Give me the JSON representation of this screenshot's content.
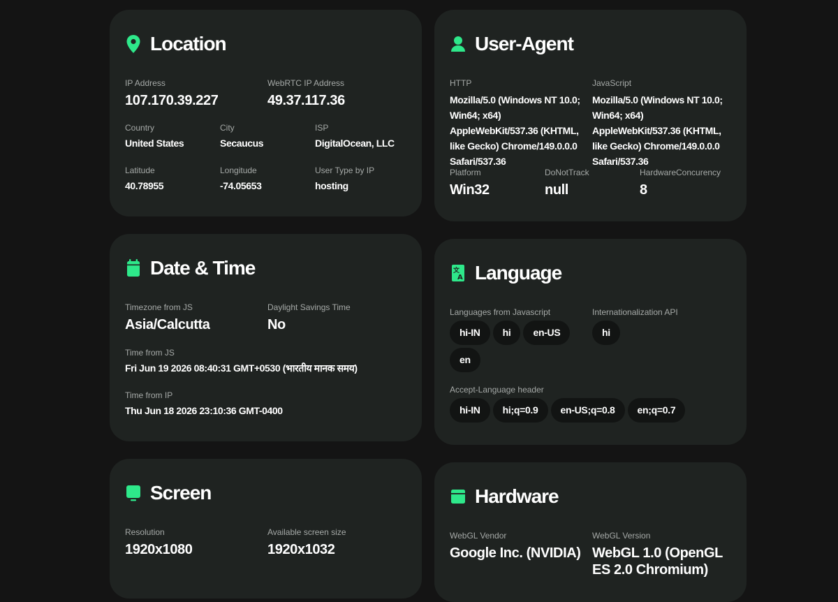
{
  "colors": {
    "accent": "#2ee88a",
    "background": "#141414",
    "card": "#1f2321",
    "label": "#a6aaa8"
  },
  "location": {
    "title": "Location",
    "icon": "map-pin-icon",
    "ip_label": "IP Address",
    "ip_value": "107.170.39.227",
    "webrtc_label": "WebRTC IP Address",
    "webrtc_value": "49.37.117.36",
    "country_label": "Country",
    "country_value": "United States",
    "city_label": "City",
    "city_value": "Secaucus",
    "isp_label": "ISP",
    "isp_value": "DigitalOcean, LLC",
    "lat_label": "Latitude",
    "lat_value": "40.78955",
    "lon_label": "Longitude",
    "lon_value": "-74.05653",
    "usertype_label": "User Type by IP",
    "usertype_value": "hosting"
  },
  "user_agent": {
    "title": "User-Agent",
    "icon": "user-icon",
    "http_label": "HTTP",
    "http_value": "Mozilla/5.0 (Windows NT 10.0; Win64; x64) AppleWebKit/537.36 (KHTML, like Gecko) Chrome/149.0.0.0 Safari/537.36",
    "js_label": "JavaScript",
    "js_value": "Mozilla/5.0 (Windows NT 10.0; Win64; x64) AppleWebKit/537.36 (KHTML, like Gecko) Chrome/149.0.0.0 Safari/537.36",
    "platform_label": "Platform",
    "platform_value": "Win32",
    "dnt_label": "DoNotTrack",
    "dnt_value": "null",
    "hwc_label": "HardwareConcurency",
    "hwc_value": "8"
  },
  "datetime": {
    "title": "Date & Time",
    "icon": "calendar-icon",
    "tz_label": "Timezone from JS",
    "tz_value": "Asia/Calcutta",
    "dst_label": "Daylight Savings Time",
    "dst_value": "No",
    "js_time_label": "Time from JS",
    "js_time_value": "Fri Jun 19 2026 08:40:31 GMT+0530 (भारतीय मानक समय)",
    "ip_time_label": "Time from IP",
    "ip_time_value": "Thu Jun 18 2026 23:10:36 GMT-0400"
  },
  "language": {
    "title": "Language",
    "icon": "translate-icon",
    "js_label": "Languages from Javascript",
    "js_langs": [
      "hi-IN",
      "hi",
      "en-US",
      "en"
    ],
    "intl_label": "Internationalization API",
    "intl_langs": [
      "hi"
    ],
    "header_label": "Accept-Language header",
    "header_langs": [
      "hi-IN",
      "hi;q=0.9",
      "en-US;q=0.8",
      "en;q=0.7"
    ]
  },
  "screen": {
    "title": "Screen",
    "icon": "monitor-icon",
    "res_label": "Resolution",
    "res_value": "1920x1080",
    "avail_label": "Available screen size",
    "avail_value": "1920x1032"
  },
  "hardware": {
    "title": "Hardware",
    "icon": "window-icon",
    "vendor_label": "WebGL Vendor",
    "vendor_value": "Google Inc. (NVIDIA)",
    "version_label": "WebGL Version",
    "version_value": "WebGL 1.0 (OpenGL ES 2.0 Chromium)"
  }
}
